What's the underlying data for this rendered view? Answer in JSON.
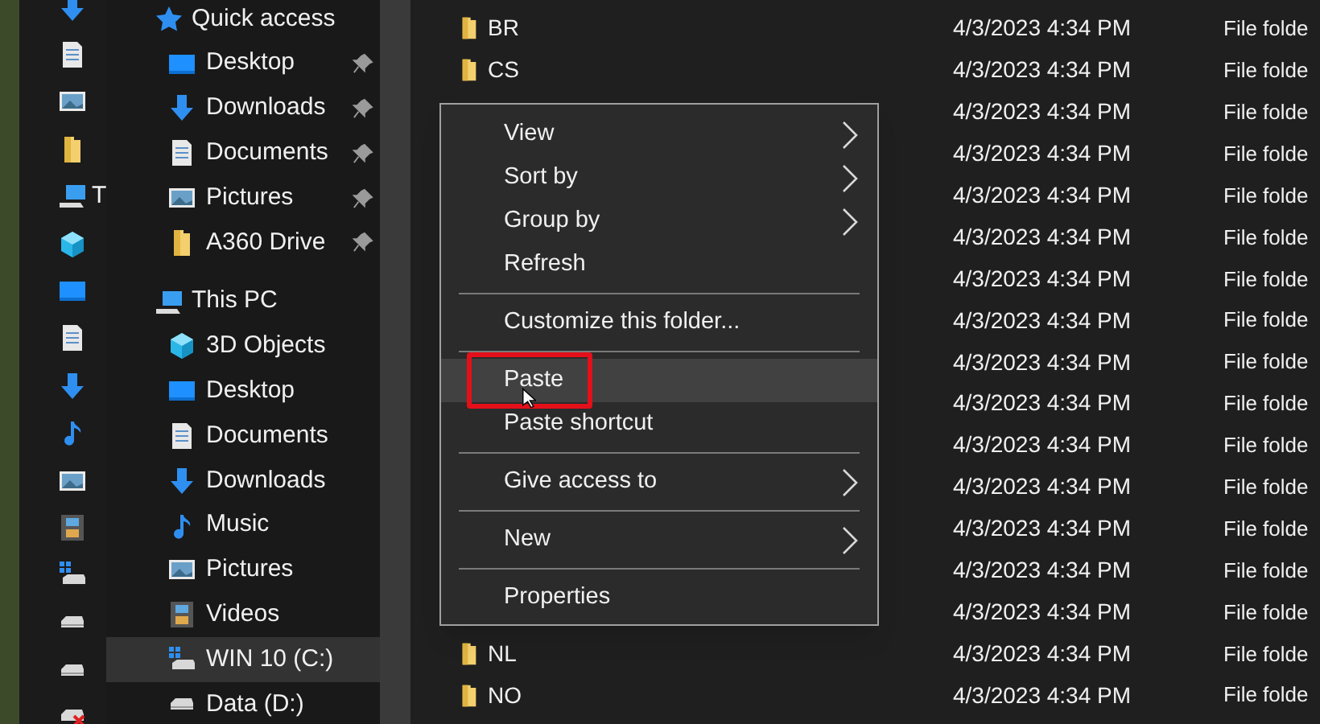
{
  "back_strip": {
    "items": [
      {
        "kind": "download"
      },
      {
        "kind": "document"
      },
      {
        "kind": "picture"
      },
      {
        "kind": "folder"
      },
      {
        "kind": "pc",
        "label": "T"
      },
      {
        "kind": "cube"
      },
      {
        "kind": "desktop"
      },
      {
        "kind": "document"
      },
      {
        "kind": "download"
      },
      {
        "kind": "music"
      },
      {
        "kind": "picture"
      },
      {
        "kind": "video"
      },
      {
        "kind": "windrive"
      },
      {
        "kind": "drive"
      },
      {
        "kind": "drive"
      },
      {
        "kind": "drive-error"
      }
    ]
  },
  "navigation": {
    "groups": [
      {
        "label": "Quick access",
        "kind": "star",
        "items": [
          {
            "label": "Desktop",
            "kind": "desktop",
            "pinned": true,
            "selected": false
          },
          {
            "label": "Downloads",
            "kind": "download",
            "pinned": true,
            "selected": false
          },
          {
            "label": "Documents",
            "kind": "document",
            "pinned": true,
            "selected": false
          },
          {
            "label": "Pictures",
            "kind": "picture",
            "pinned": true,
            "selected": false
          },
          {
            "label": "A360 Drive",
            "kind": "folder",
            "pinned": true,
            "selected": false
          }
        ]
      },
      {
        "label": "This PC",
        "kind": "pc",
        "items": [
          {
            "label": "3D Objects",
            "kind": "cube",
            "pinned": false,
            "selected": false
          },
          {
            "label": "Desktop",
            "kind": "desktop",
            "pinned": false,
            "selected": false
          },
          {
            "label": "Documents",
            "kind": "document",
            "pinned": false,
            "selected": false
          },
          {
            "label": "Downloads",
            "kind": "download",
            "pinned": false,
            "selected": false
          },
          {
            "label": "Music",
            "kind": "music",
            "pinned": false,
            "selected": false
          },
          {
            "label": "Pictures",
            "kind": "picture",
            "pinned": false,
            "selected": false
          },
          {
            "label": "Videos",
            "kind": "video",
            "pinned": false,
            "selected": false
          },
          {
            "label": "WIN 10 (C:)",
            "kind": "windrive",
            "pinned": false,
            "selected": true
          },
          {
            "label": "Data (D:)",
            "kind": "drive",
            "pinned": false,
            "selected": false
          }
        ]
      }
    ]
  },
  "files": [
    {
      "name": "BR",
      "modified": "4/3/2023 4:34 PM",
      "type": "File folde"
    },
    {
      "name": "CS",
      "modified": "4/3/2023 4:34 PM",
      "type": "File folde"
    },
    {
      "modified": "4/3/2023 4:34 PM",
      "type": "File folde"
    },
    {
      "modified": "4/3/2023 4:34 PM",
      "type": "File folde"
    },
    {
      "modified": "4/3/2023 4:34 PM",
      "type": "File folde"
    },
    {
      "modified": "4/3/2023 4:34 PM",
      "type": "File folde"
    },
    {
      "modified": "4/3/2023 4:34 PM",
      "type": "File folde"
    },
    {
      "modified": "4/3/2023 4:34 PM",
      "type": "File folde"
    },
    {
      "modified": "4/3/2023 4:34 PM",
      "type": "File folde"
    },
    {
      "modified": "4/3/2023 4:34 PM",
      "type": "File folde"
    },
    {
      "modified": "4/3/2023 4:34 PM",
      "type": "File folde"
    },
    {
      "modified": "4/3/2023 4:34 PM",
      "type": "File folde"
    },
    {
      "modified": "4/3/2023 4:34 PM",
      "type": "File folde"
    },
    {
      "modified": "4/3/2023 4:34 PM",
      "type": "File folde"
    },
    {
      "modified": "4/3/2023 4:34 PM",
      "type": "File folde"
    },
    {
      "name": "NL",
      "modified": "4/3/2023 4:34 PM",
      "type": "File folde"
    },
    {
      "name": "NO",
      "modified": "4/3/2023 4:34 PM",
      "type": "File folde"
    }
  ],
  "context_menu": {
    "items": [
      {
        "kind": "item",
        "label": "View",
        "submenu": true,
        "highlighted": false,
        "annotated": false
      },
      {
        "kind": "item",
        "label": "Sort by",
        "submenu": true,
        "highlighted": false,
        "annotated": false
      },
      {
        "kind": "item",
        "label": "Group by",
        "submenu": true,
        "highlighted": false,
        "annotated": false
      },
      {
        "kind": "item",
        "label": "Refresh",
        "submenu": false,
        "highlighted": false,
        "annotated": false
      },
      {
        "kind": "separator"
      },
      {
        "kind": "item",
        "label": "Customize this folder...",
        "submenu": false,
        "highlighted": false,
        "annotated": false
      },
      {
        "kind": "separator"
      },
      {
        "kind": "item",
        "label": "Paste",
        "submenu": false,
        "highlighted": true,
        "annotated": true
      },
      {
        "kind": "item",
        "label": "Paste shortcut",
        "submenu": false,
        "highlighted": false,
        "annotated": false
      },
      {
        "kind": "separator"
      },
      {
        "kind": "item",
        "label": "Give access to",
        "submenu": true,
        "highlighted": false,
        "annotated": false
      },
      {
        "kind": "separator"
      },
      {
        "kind": "item",
        "label": "New",
        "submenu": true,
        "highlighted": false,
        "annotated": false
      },
      {
        "kind": "separator"
      },
      {
        "kind": "item",
        "label": "Properties",
        "submenu": false,
        "highlighted": false,
        "annotated": false
      }
    ]
  }
}
